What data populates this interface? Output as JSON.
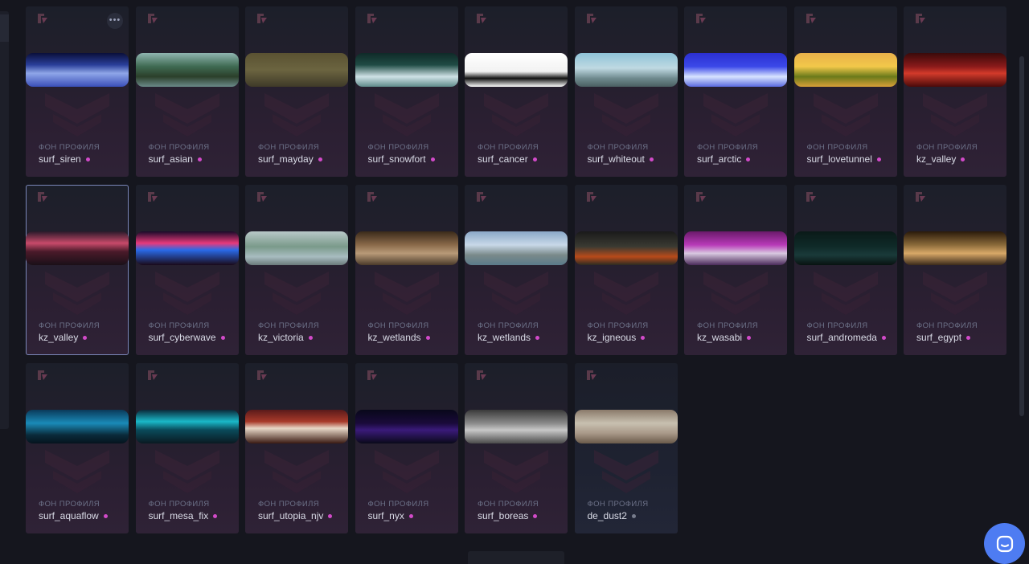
{
  "card_label": "ФОН ПРОФИЛЯ",
  "more_label": "•••",
  "colors": {
    "accent_dot": "#d24ac9",
    "muted_dot": "#777c8c",
    "chat_button": "#4e7cf2"
  },
  "cards": [
    {
      "name": "surf_siren",
      "thumb": "linear-gradient(180deg,#0a0f3a 0%,#2a3f9a 35%,#8fa6e8 60%,#3a4fb8 100%)"
    },
    {
      "name": "surf_asian",
      "thumb": "linear-gradient(180deg,#8fb5b0 0%,#3f6a52 40%,#2b3f2a 70%,#6a8a8a 100%)"
    },
    {
      "name": "surf_mayday",
      "thumb": "linear-gradient(180deg,#5a5232 0%,#6b6440 50%,#3f3a28 100%)"
    },
    {
      "name": "surf_snowfort",
      "thumb": "linear-gradient(180deg,#0f2a28 0%,#1f4b44 35%,#cfe2e6 70%,#5f8a8a 100%)"
    },
    {
      "name": "surf_cancer",
      "thumb": "linear-gradient(180deg,#ffffff 0%,#f2f2f2 55%,#111111 75%,#ffffff 100%)"
    },
    {
      "name": "surf_whiteout",
      "thumb": "linear-gradient(180deg,#8fc3d8 0%,#bfd9e2 45%,#6f8a8e 75%,#4a5f62 100%)"
    },
    {
      "name": "surf_arctic",
      "thumb": "linear-gradient(180deg,#2b2fd0 0%,#3b48e8 40%,#d8e4ff 70%,#5a6adf 100%)"
    },
    {
      "name": "surf_lovetunnel",
      "thumb": "linear-gradient(180deg,#e8b04a 0%,#f2c84a 40%,#6a7a1a 70%,#d8a038 100%)"
    },
    {
      "name": "kz_valley",
      "thumb": "linear-gradient(180deg,#3a0a0a 0%,#8a1a1a 40%,#d23a2a 60%,#4a0a0a 100%)"
    },
    {
      "name": "kz_valley",
      "selected": true,
      "thumb": "linear-gradient(180deg,#2a1a2a 0%,#c84a6a 35%,#4a1a2a 60%,#1a1018 100%)"
    },
    {
      "name": "surf_cyberwave",
      "thumb": "linear-gradient(180deg,#1a0a2a 0%,#e83a7a 35%,#2a6ae8 55%,#1a0a1a 100%)"
    },
    {
      "name": "kz_victoria",
      "thumb": "linear-gradient(180deg,#b8c8c8 0%,#7a9a8a 45%,#a8bcc0 75%,#6a7a7a 100%)"
    },
    {
      "name": "kz_wetlands",
      "thumb": "linear-gradient(180deg,#3a2a1a 0%,#8a6a4a 40%,#b89a78 65%,#4a3a2a 100%)"
    },
    {
      "name": "kz_wetlands",
      "thumb": "linear-gradient(180deg,#8aa8c8 0%,#c8d8e8 40%,#7a8a8a 70%,#5a7a8a 100%)"
    },
    {
      "name": "kz_igneous",
      "thumb": "linear-gradient(180deg,#1a1a1a 0%,#3a3a32 45%,#b84a1a 75%,#2a2a22 100%)"
    },
    {
      "name": "kz_wasabi",
      "thumb": "linear-gradient(180deg,#6a1a6a 0%,#b83ab8 40%,#d8c8e0 65%,#4a2a5a 100%)"
    },
    {
      "name": "surf_andromeda",
      "thumb": "linear-gradient(180deg,#0a1a18 0%,#0f2a28 45%,#1a3a3a 70%,#081210 100%)"
    },
    {
      "name": "surf_egypt",
      "thumb": "linear-gradient(180deg,#2a1a0a 0%,#8a6a3a 40%,#d8a868 65%,#3a2a1a 100%)"
    },
    {
      "name": "surf_aquaflow",
      "thumb": "linear-gradient(180deg,#0a3a5a 0%,#1a8ab8 40%,#0a2a3a 75%,#05141e 100%)"
    },
    {
      "name": "surf_mesa_fix",
      "thumb": "linear-gradient(180deg,#0a2a3a 0%,#1ab8c8 35%,#0a4a5a 60%,#0a1a22 100%)"
    },
    {
      "name": "surf_utopia_njv",
      "thumb": "linear-gradient(180deg,#5a1a1a 0%,#a83a2a 35%,#e8d8c8 55%,#3a1a12 100%)"
    },
    {
      "name": "surf_nyx",
      "thumb": "linear-gradient(180deg,#08081a 0%,#1a0a3a 40%,#3a1a7a 60%,#0a0a1a 100%)"
    },
    {
      "name": "surf_boreas",
      "thumb": "linear-gradient(180deg,#3a3a3a 0%,#8a8a8a 40%,#c8c8c8 60%,#4a4a4a 100%)"
    },
    {
      "name": "de_dust2",
      "muted": true,
      "thumb": "linear-gradient(180deg,#8a7a6a 0%,#c8c0b0 40%,#a89888 70%,#6a5a4a 100%)"
    }
  ]
}
